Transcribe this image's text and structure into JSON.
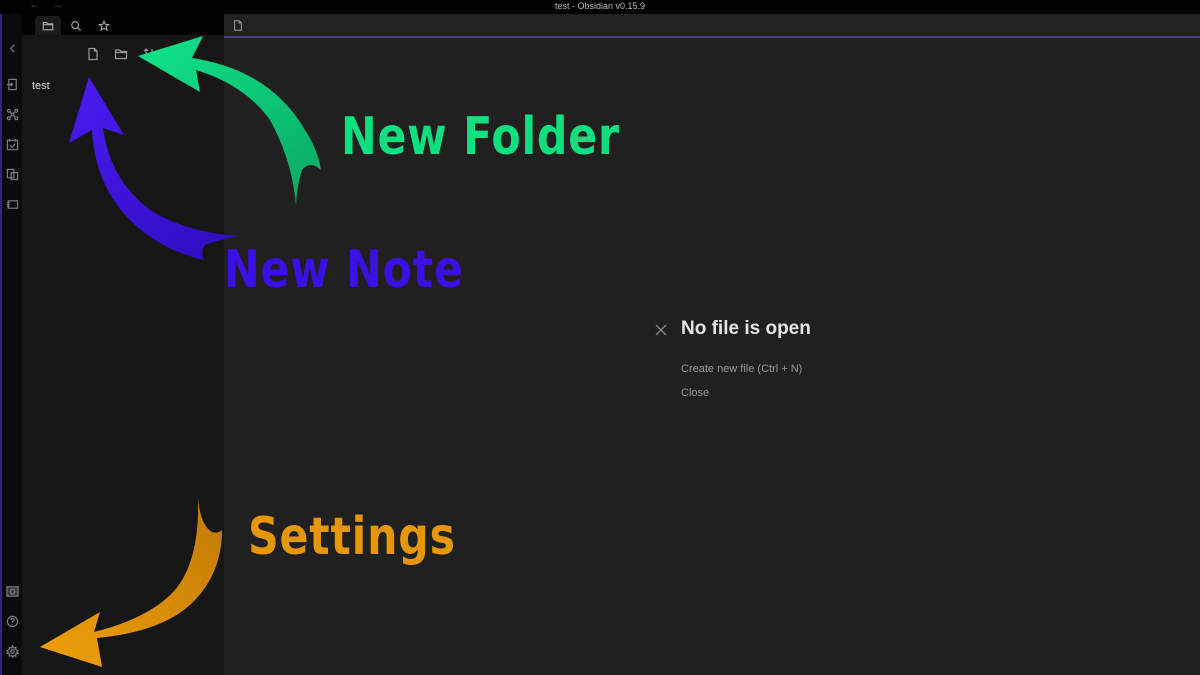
{
  "window": {
    "title": "test - Obsidian v0.15.9",
    "back_icon": "←",
    "forward_icon": "→"
  },
  "ribbon": {
    "collapse_icon": "chevron-left-icon",
    "top_items": [
      {
        "name": "open-quick-switcher",
        "icon": "switcher-icon"
      },
      {
        "name": "open-graph-view",
        "icon": "graph-icon"
      },
      {
        "name": "open-daily-note",
        "icon": "calendar-icon"
      },
      {
        "name": "insert-template",
        "icon": "template-icon"
      },
      {
        "name": "open-command-palette",
        "icon": "terminal-icon"
      }
    ],
    "bottom_items": [
      {
        "name": "open-another-vault",
        "icon": "vault-icon"
      },
      {
        "name": "help",
        "icon": "help-icon"
      },
      {
        "name": "settings",
        "icon": "gear-icon"
      }
    ]
  },
  "sidebar": {
    "tabs": [
      {
        "name": "file-explorer",
        "icon": "folder-icon",
        "active": true
      },
      {
        "name": "search",
        "icon": "search-icon",
        "active": false
      },
      {
        "name": "starred",
        "icon": "star-icon",
        "active": false
      }
    ],
    "actions": [
      {
        "name": "new-note",
        "icon": "file-icon"
      },
      {
        "name": "new-folder",
        "icon": "folder-icon"
      },
      {
        "name": "sort",
        "icon": "sort-icon"
      }
    ],
    "files": [
      "test"
    ]
  },
  "main": {
    "empty_state": {
      "heading": "No file is open",
      "create_label": "Create new file (Ctrl + N)",
      "close_label": "Close"
    }
  },
  "annotations": [
    {
      "label": "New Folder",
      "color": "#0ee07f"
    },
    {
      "label": "New Note",
      "color": "#3a10e5"
    },
    {
      "label": "Settings",
      "color": "#e69707"
    }
  ],
  "colors": {
    "accent": "#4b3d8a",
    "background": "#202020",
    "sidebar": "#161616"
  }
}
